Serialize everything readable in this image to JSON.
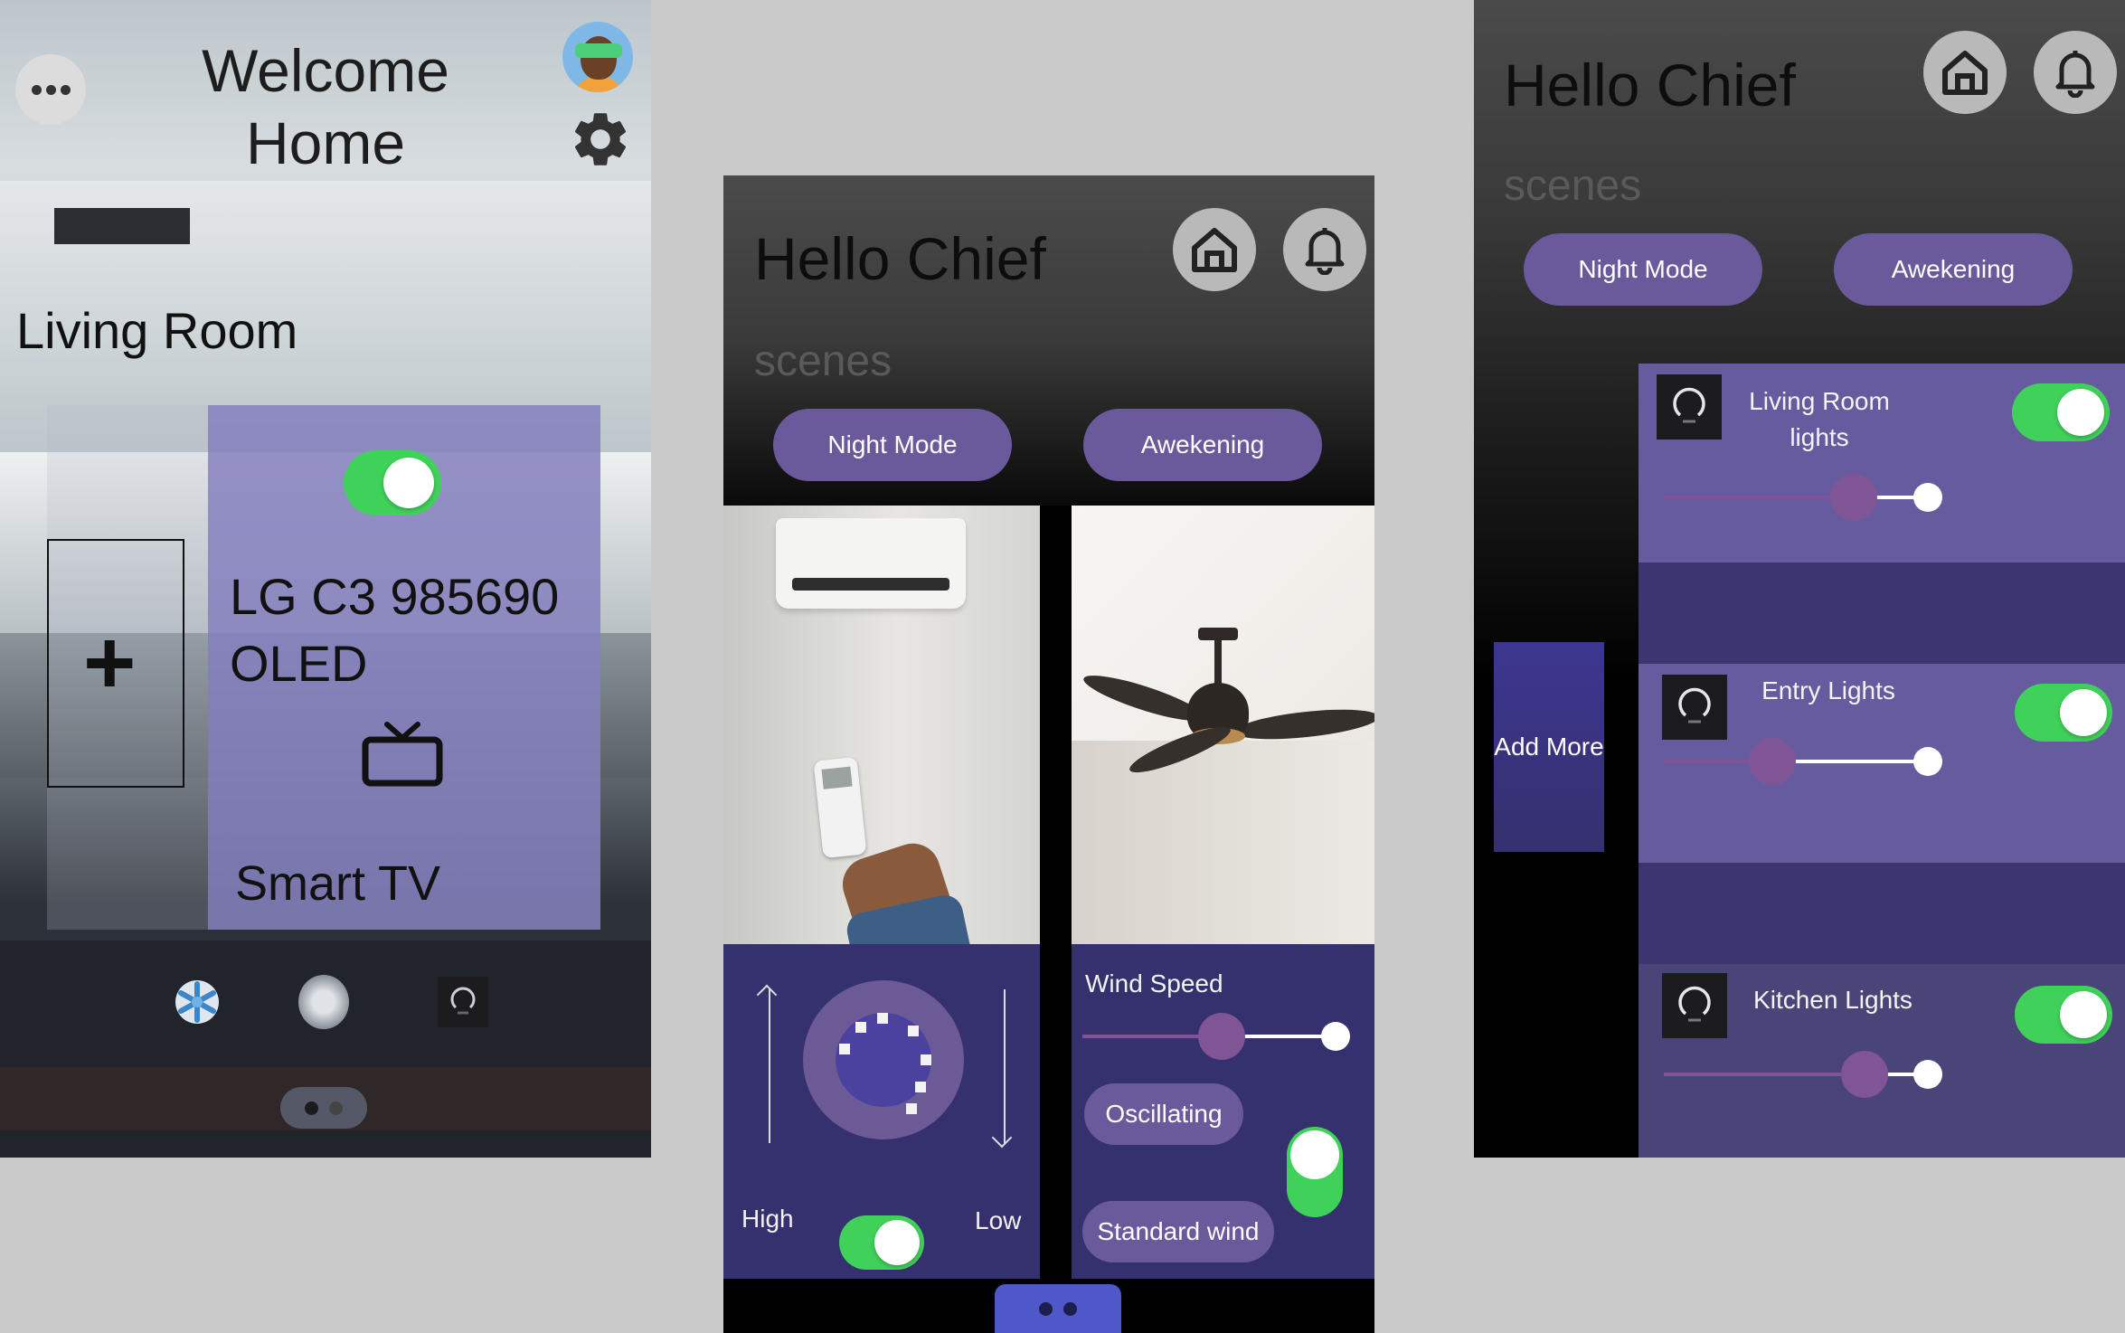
{
  "screen1": {
    "welcome_line1": "Welcome",
    "welcome_line2": "Home",
    "room_title": "Living Room",
    "add_symbol": "+",
    "device_card": {
      "model": "LG C3 985690 OLED",
      "name": "Smart TV",
      "power_on": true
    },
    "devices": [
      "ac-icon",
      "fan-icon",
      "light-bulb-icon"
    ],
    "pager": {
      "pages": 2,
      "active": 1
    }
  },
  "screen2": {
    "greeting": "Hello Chief",
    "scenes_label": "scenes",
    "scenes": [
      "Night Mode",
      "Awekening"
    ],
    "ac": {
      "high_label": "High",
      "low_label": "Low",
      "power_on": true
    },
    "fan": {
      "wind_speed_label": "Wind Speed",
      "wind_speed_level": 0.55,
      "oscillating_label": "Oscillating",
      "standard_wind_label": "Standard wind",
      "oscillating_on": true
    },
    "pager": {
      "pages": 2,
      "active": 1
    }
  },
  "screen3": {
    "greeting": "Hello Chief",
    "scenes_label": "scenes",
    "scenes": [
      "Night Mode",
      "Awekening"
    ],
    "add_more_label": "Add More",
    "lights": [
      {
        "name": "Living Room lights",
        "on": true,
        "brightness": 0.72
      },
      {
        "name": "Entry Lights",
        "on": true,
        "brightness": 0.41
      },
      {
        "name": "Kitchen Lights",
        "on": true,
        "brightness": 0.76
      }
    ]
  },
  "colors": {
    "accent_purple": "#6a5a9c",
    "panel_navy": "#35306e",
    "toggle_green": "#3fd15a",
    "card_lavender": "#827ebe"
  }
}
